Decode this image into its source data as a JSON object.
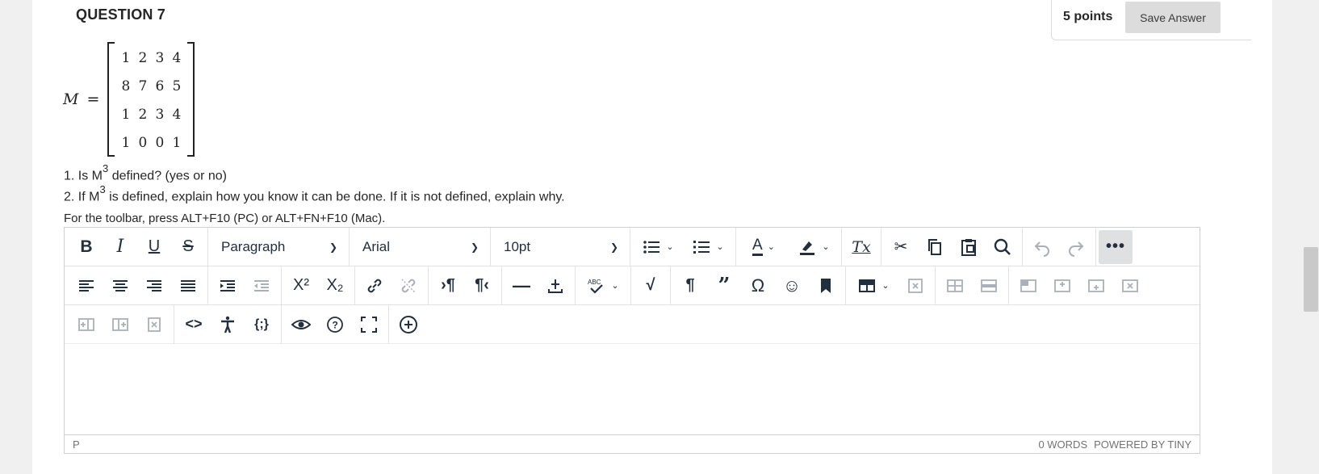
{
  "question": {
    "title": "QUESTION 7",
    "points": "5 points",
    "save_label": "Save Answer"
  },
  "matrix": {
    "variable": "M",
    "equals": "=",
    "rows": [
      [
        "1",
        "2",
        "3",
        "4"
      ],
      [
        "8",
        "7",
        "6",
        "5"
      ],
      [
        "1",
        "2",
        "3",
        "4"
      ],
      [
        "1",
        "0",
        "0",
        "1"
      ]
    ]
  },
  "prompt": {
    "line1_pre": "1. Is M",
    "line1_sup": "3",
    "line1_post": " defined? (yes or no)",
    "line2_pre": "2. If M",
    "line2_sup": "3",
    "line2_post": " is defined, explain how you know it can be done. If it is not defined, explain why.",
    "toolbar_hint": "For the toolbar, press ALT+F10 (PC) or ALT+FN+F10 (Mac)."
  },
  "editor": {
    "block_format": "Paragraph",
    "font_family": "Arial",
    "font_size": "10pt",
    "status_path": "P",
    "word_count": "0 WORDS",
    "powered_by": "POWERED BY TINY",
    "icons": {
      "bold": "B",
      "italic": "I",
      "underline": "U",
      "strike": "S",
      "bullet_list": "bullet-list-icon",
      "numbered_list": "numbered-list-icon",
      "text_color": "A",
      "highlight": "highlight-icon",
      "clear_format": "Tx",
      "more": "•••"
    }
  },
  "colors": {
    "toolbar_icon": "#222f3e",
    "disabled_icon": "#aab0b7",
    "save_button_bg": "#dcdcdc",
    "page_bg": "#f0f0f0"
  }
}
